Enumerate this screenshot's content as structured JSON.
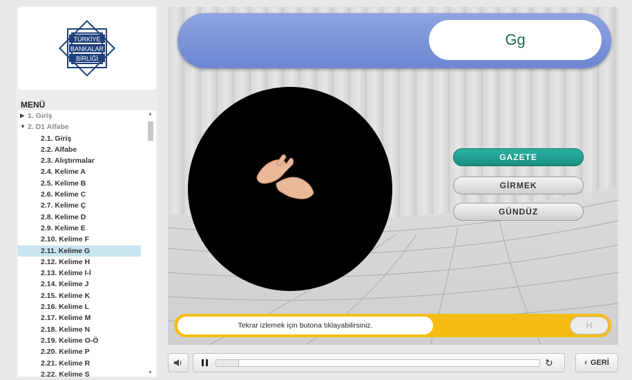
{
  "logo": {
    "lines": [
      "TÜRKİYE",
      "BANKALAR",
      "BİRLİĞİ"
    ]
  },
  "menu": {
    "title": "MENÜ",
    "sections": [
      {
        "label": "1. Giriş",
        "expanded": false
      },
      {
        "label": "2. D1 Alfabe",
        "expanded": true
      }
    ],
    "items": [
      "2.1. Giriş",
      "2.2. Alfabe",
      "2.3. Alıştırmalar",
      "2.4. Kelime A",
      "2.5. Kelime B",
      "2.6. Kelime C",
      "2.7. Kelime Ç",
      "2.8. Kelime D",
      "2.9. Kelime E",
      "2.10. Kelime F",
      "2.11. Kelime G",
      "2.12. Kelime H",
      "2.13. Kelime I-İ",
      "2.14. Kelime J",
      "2.15. Kelime K",
      "2.16. Kelime L",
      "2.17. Kelime M",
      "2.18. Kelime N",
      "2.19. Kelime O-Ö",
      "2.20. Kelime P",
      "2.21. Kelime R",
      "2.22. Kelime S"
    ],
    "selected_index": 10
  },
  "stage": {
    "title_letter": "Gg",
    "options": [
      "GAZETE",
      "GİRMEK",
      "GÜNDÜZ"
    ],
    "active_option_index": 0,
    "hint_text": "Tekrar izlemek için butona tıklayabilirsiniz.",
    "hint_button_label": "H"
  },
  "controls": {
    "back_label": "GERİ",
    "progress_fraction": 0.07
  },
  "colors": {
    "title_bar": "#7890d8",
    "active_option": "#22a294",
    "hint_bar": "#f7bc14",
    "selected_menu": "#c8e4f0"
  }
}
